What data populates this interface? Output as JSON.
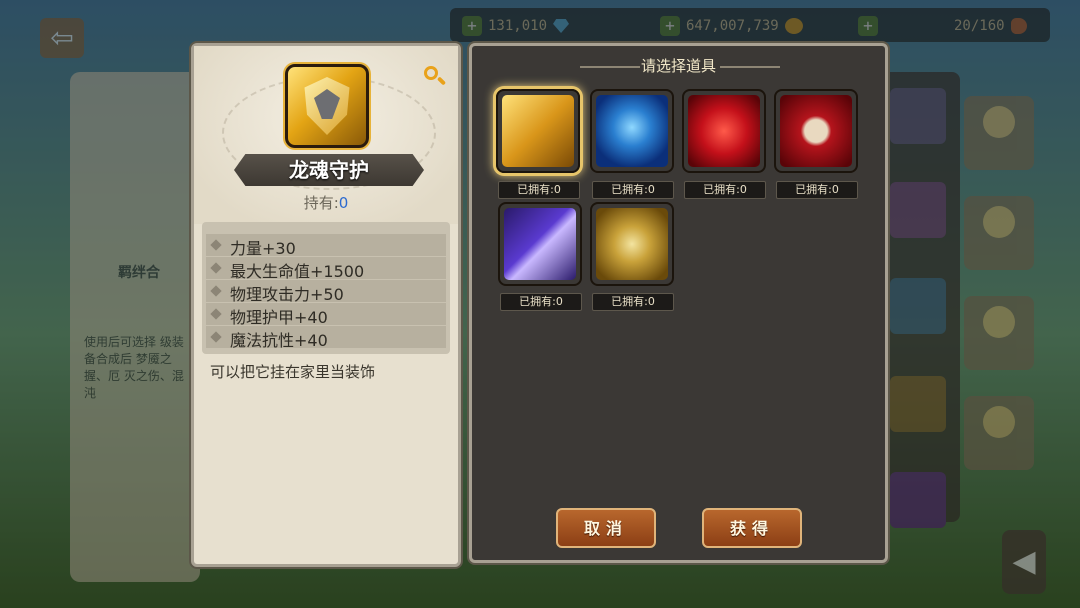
{
  "background": {
    "resources": [
      {
        "name": "diamond",
        "value": "131,010"
      },
      {
        "name": "gold",
        "value": "647,007,739"
      },
      {
        "name": "stamina",
        "value": "20/160"
      }
    ],
    "left_panel_title": "羁绊合",
    "left_panel_desc": "使用后可选择 级装备合成后 梦魇之握、厄 灭之伤、混沌"
  },
  "info": {
    "title": "龙魂守护",
    "owned_label": "持有:",
    "owned_value": "0",
    "stats": [
      "力量+30",
      "最大生命值+1500",
      "物理攻击力+50",
      "物理护甲+40",
      "魔法抗性+40"
    ],
    "description": "可以把它挂在家里当装饰"
  },
  "select": {
    "title": "请选择道具",
    "items": [
      {
        "name": "dragon-soul-guard",
        "owned_label": "已拥有:",
        "owned_value": "0",
        "selected": true
      },
      {
        "name": "blue-ring",
        "owned_label": "已拥有:",
        "owned_value": "0",
        "selected": false
      },
      {
        "name": "battle-axe",
        "owned_label": "已拥有:",
        "owned_value": "0",
        "selected": false
      },
      {
        "name": "skull-staff",
        "owned_label": "已拥有:",
        "owned_value": "0",
        "selected": false
      },
      {
        "name": "purple-bow",
        "owned_label": "已拥有:",
        "owned_value": "0",
        "selected": false
      },
      {
        "name": "gold-ore",
        "owned_label": "已拥有:",
        "owned_value": "0",
        "selected": false
      }
    ],
    "cancel_label": "取消",
    "confirm_label": "获得"
  }
}
